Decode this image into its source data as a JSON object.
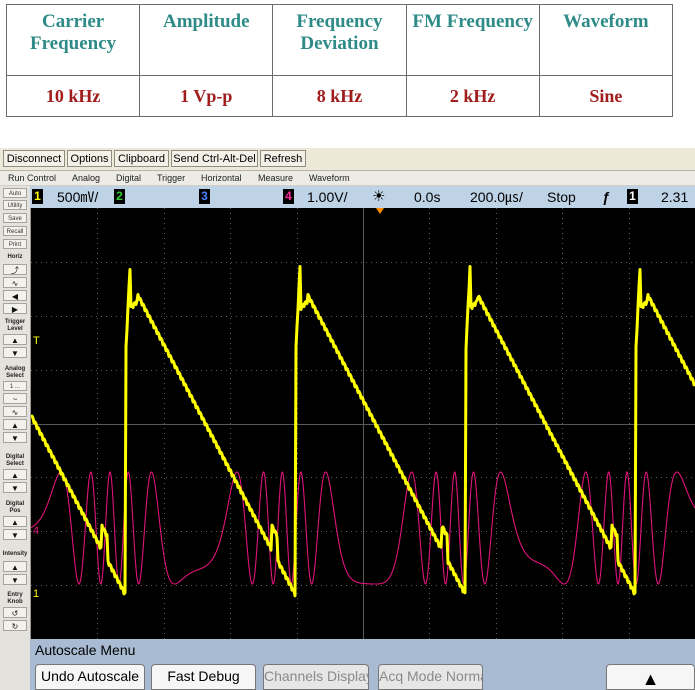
{
  "table": {
    "headers": [
      "Carrier Frequency",
      "Amplitude",
      "Frequency Deviation",
      "FM Frequency",
      "Waveform"
    ],
    "values": [
      "10 kHz",
      "1 Vp-p",
      "8 kHz",
      "2 kHz",
      "Sine"
    ]
  },
  "toolbar": {
    "buttons": [
      "Disconnect",
      "Options",
      "Clipboard",
      "Send Ctrl-Alt-Del",
      "Refresh"
    ]
  },
  "menubar": {
    "items": [
      "Run Control",
      "Analog",
      "Digital",
      "Trigger",
      "Horizontal",
      "Measure",
      "Waveform"
    ]
  },
  "status": {
    "ch1_num": "1",
    "ch1_scale": "500㎷/",
    "ch2_num": "2",
    "ch3_num": "3",
    "ch4_num": "4",
    "ch4_scale": "1.00V/",
    "delay": "0.0s",
    "timebase": "200.0㎲/",
    "run_state": "Stop",
    "trig_slope": "ƒ",
    "trig_src": "1",
    "trig_level": "2.31"
  },
  "left_panel": {
    "buttons": [
      "Auto Scale",
      "Utility",
      "Save",
      "Recall",
      "Print"
    ],
    "horiz_label": "Horiz",
    "trigger_label": "Trigger Level",
    "analog_label": "Analog Select",
    "analog_value": "1 ...",
    "digital_select_label": "Digital Select",
    "digital_pos_label": "Digital Pos",
    "intensity_label": "Intensity",
    "entry_label": "Entry Knob"
  },
  "screen": {
    "ch1_color": "#ffff00",
    "ch4_color": "#e0147a",
    "trigger_marker": "T",
    "ch4_marker": "4",
    "ch1_marker": "1"
  },
  "softkeys": {
    "title": "Autoscale Menu",
    "buttons": [
      "Undo Autoscale",
      "Fast Debug",
      "Channels Displayed",
      "Acq Mode Normal"
    ]
  }
}
